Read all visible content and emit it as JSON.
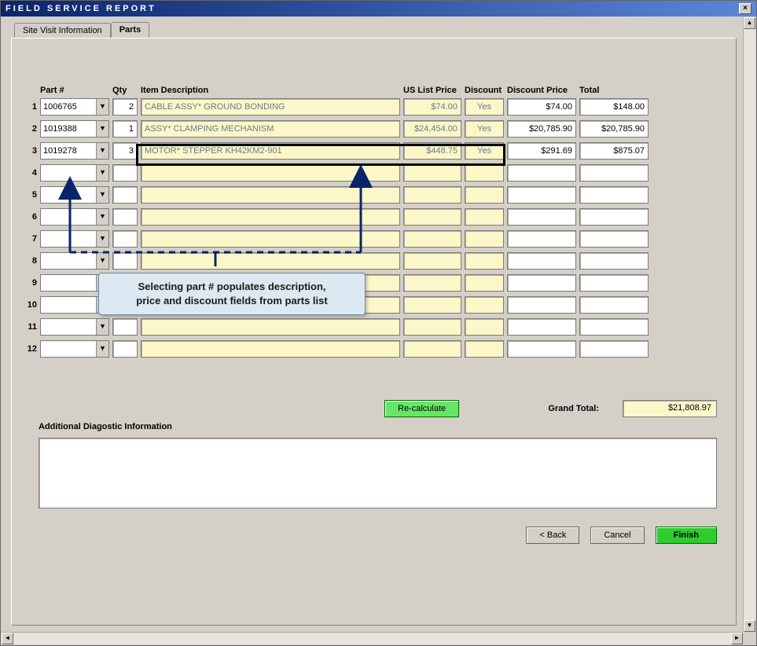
{
  "window": {
    "title": "FIELD SERVICE REPORT",
    "close": "×"
  },
  "tabs": {
    "inactive": "Site Visit Information",
    "active": "Parts"
  },
  "headers": {
    "part": "Part #",
    "qty": "Qty",
    "desc": "Item Description",
    "price": "US List Price",
    "disc": "Discount",
    "dprice": "Discount Price",
    "total": "Total"
  },
  "rows": [
    {
      "n": "1",
      "part": "1006765",
      "qty": "2",
      "desc": "CABLE ASSY* GROUND BONDING",
      "price": "$74.00",
      "disc": "Yes",
      "dprice": "$74.00",
      "total": "$148.00"
    },
    {
      "n": "2",
      "part": "1019388",
      "qty": "1",
      "desc": "ASSY* CLAMPING MECHANISM",
      "price": "$24,454.00",
      "disc": "Yes",
      "dprice": "$20,785.90",
      "total": "$20,785.90"
    },
    {
      "n": "3",
      "part": "1019278",
      "qty": "3",
      "desc": "MOTOR* STEPPER KH42KM2-901",
      "price": "$448.75",
      "disc": "Yes",
      "dprice": "$291.69",
      "total": "$875.07"
    },
    {
      "n": "4",
      "part": "",
      "qty": "",
      "desc": "",
      "price": "",
      "disc": "",
      "dprice": "",
      "total": ""
    },
    {
      "n": "5",
      "part": "",
      "qty": "",
      "desc": "",
      "price": "",
      "disc": "",
      "dprice": "",
      "total": ""
    },
    {
      "n": "6",
      "part": "",
      "qty": "",
      "desc": "",
      "price": "",
      "disc": "",
      "dprice": "",
      "total": ""
    },
    {
      "n": "7",
      "part": "",
      "qty": "",
      "desc": "",
      "price": "",
      "disc": "",
      "dprice": "",
      "total": ""
    },
    {
      "n": "8",
      "part": "",
      "qty": "",
      "desc": "",
      "price": "",
      "disc": "",
      "dprice": "",
      "total": ""
    },
    {
      "n": "9",
      "part": "",
      "qty": "",
      "desc": "",
      "price": "",
      "disc": "",
      "dprice": "",
      "total": ""
    },
    {
      "n": "10",
      "part": "",
      "qty": "",
      "desc": "",
      "price": "",
      "disc": "",
      "dprice": "",
      "total": ""
    },
    {
      "n": "11",
      "part": "",
      "qty": "",
      "desc": "",
      "price": "",
      "disc": "",
      "dprice": "",
      "total": ""
    },
    {
      "n": "12",
      "part": "",
      "qty": "",
      "desc": "",
      "price": "",
      "disc": "",
      "dprice": "",
      "total": ""
    }
  ],
  "callout": "Selecting part # populates description,\nprice and discount fields from parts list",
  "recalc": "Re-calculate",
  "grand_label": "Grand Total:",
  "grand_total": "$21,808.97",
  "diag_label": "Additional Diagostic Information",
  "diag_text": "",
  "buttons": {
    "back": "< Back",
    "cancel": "Cancel",
    "finish": "Finish"
  }
}
